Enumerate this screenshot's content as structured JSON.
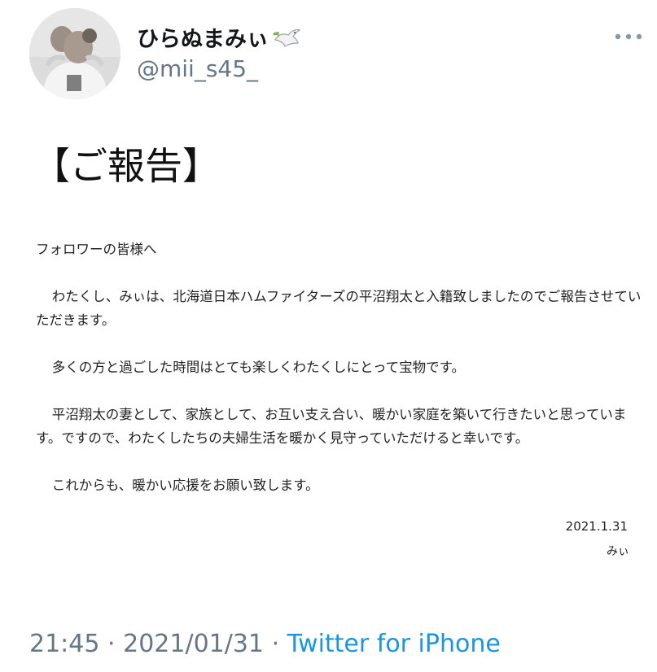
{
  "author": {
    "display_name": "ひらぬまみぃ",
    "handle": "@mii_s45_",
    "name_emoji_icon": "dove-with-olive-branch-icon",
    "avatar_icon": "profile-photo-avatar"
  },
  "menu": {
    "more_icon": "more-horizontal-icon"
  },
  "document": {
    "title": "【ご報告】",
    "greeting": "フォロワーの皆様へ",
    "paragraphs": [
      "わたくし、みぃは、北海道日本ハムファイターズの平沼翔太と入籍致しましたのでご報告させていただきます。",
      "多くの方と過ごした時間はとても楽しくわたくしにとって宝物です。",
      "平沼翔太の妻として、家族として、お互い支え合い、暖かい家庭を築いて行きたいと思っています。ですので、わたくしたちの夫婦生活を暖かく見守っていただけると幸いです。",
      "これからも、暖かい応援をお願い致します。"
    ],
    "signature_date": "2021.1.31",
    "signature_name": "みぃ"
  },
  "tweet_meta": {
    "time": "21:45",
    "separator": "·",
    "date": "2021/01/31",
    "source": "Twitter for iPhone"
  },
  "colors": {
    "text": "#14171a",
    "secondary": "#657786",
    "link": "#1b95e0"
  }
}
